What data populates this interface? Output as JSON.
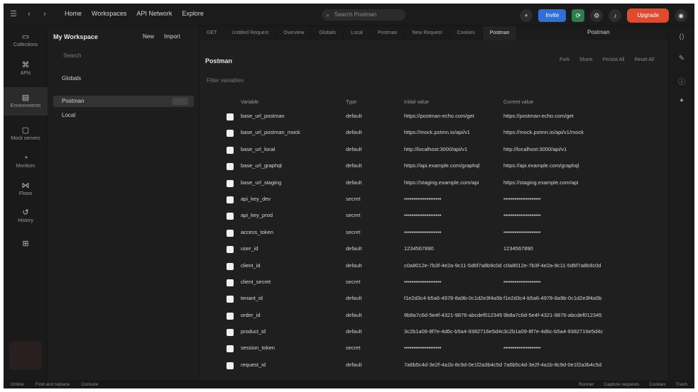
{
  "topbar": {
    "menu": [
      "Home",
      "Workspaces",
      "API Network",
      "Explore"
    ],
    "search_placeholder": "Search Postman",
    "invite_label": "Invite",
    "upgrade_label": "Upgrade"
  },
  "rail": [
    {
      "label": "Collections",
      "icon": "folder-icon"
    },
    {
      "label": "APIs",
      "icon": "api-icon"
    },
    {
      "label": "Environments",
      "icon": "environment-icon"
    },
    {
      "label": "Mock servers",
      "icon": "mock-icon"
    },
    {
      "label": "Monitors",
      "icon": "monitor-icon"
    },
    {
      "label": "Flows",
      "icon": "flow-icon"
    },
    {
      "label": "History",
      "icon": "history-icon"
    }
  ],
  "sidebar": {
    "title": "My Workspace",
    "new_label": "New",
    "import_label": "Import",
    "search_placeholder": "Search",
    "items": [
      "Globals",
      "Postman",
      "Local"
    ]
  },
  "tabs": [
    "GET",
    "Untitled Request",
    "Overview",
    "Globals",
    "Local",
    "Postman",
    "New Request",
    "Cookies",
    "Postman"
  ],
  "env_select": "Postman",
  "workspace": {
    "title": "Postman",
    "actions": [
      "Fork",
      "Share",
      "Persist All",
      "Reset All"
    ],
    "filter_placeholder": "Filter variables"
  },
  "table": {
    "headers": [
      "Variable",
      "Type",
      "Initial value",
      "Current value"
    ],
    "rows": [
      [
        "base_url_postman",
        "default",
        "https://postman-echo.com/get",
        "https://postman-echo.com/get"
      ],
      [
        "base_url_postman_mock",
        "default",
        "https://mock.pstmn.io/api/v1",
        "https://mock.pstmn.io/api/v1/mock"
      ],
      [
        "base_url_local",
        "default",
        "http://localhost:3000/api/v1",
        "http://localhost:3000/api/v1"
      ],
      [
        "base_url_graphql",
        "default",
        "https://api.example.com/graphql",
        "https://api.example.com/graphql"
      ],
      [
        "base_url_staging",
        "default",
        "https://staging.example.com/api",
        "https://staging.example.com/api"
      ],
      [
        "api_key_dev",
        "secret",
        "••••••••••••••••••••",
        "••••••••••••••••••••"
      ],
      [
        "api_key_prod",
        "secret",
        "••••••••••••••••••••",
        "••••••••••••••••••••"
      ],
      [
        "access_token",
        "secret",
        "••••••••••••••••••••",
        "••••••••••••••••••••"
      ],
      [
        "user_id",
        "default",
        "1234567890",
        "1234567890"
      ],
      [
        "client_id",
        "default",
        "c0a8012e-7b3f-4e2a-9c11-5d6f7a8b9c0d",
        "c0a8012e-7b3f-4e2a-9c11-5d6f7a8b9c0d"
      ],
      [
        "client_secret",
        "secret",
        "••••••••••••••••••••",
        "••••••••••••••••••••"
      ],
      [
        "tenant_id",
        "default",
        "f1e2d3c4-b5a6-4978-8a9b-0c1d2e3f4a5b",
        "f1e2d3c4-b5a6-4978-8a9b-0c1d2e3f4a5b"
      ],
      [
        "order_id",
        "default",
        "9b8a7c6d-5e4f-4321-9876-abcdef012345",
        "9b8a7c6d-5e4f-4321-9876-abcdef012345"
      ],
      [
        "product_id",
        "default",
        "3c2b1a09-8f7e-4d6c-b5a4-9382716e5d4c",
        "3c2b1a09-8f7e-4d6c-b5a4-9382716e5d4c"
      ],
      [
        "session_token",
        "secret",
        "••••••••••••••••••••",
        "••••••••••••••••••••"
      ],
      [
        "request_id",
        "default",
        "7a6b5c4d-3e2f-4a1b-8c9d-0e1f2a3b4c5d",
        "7a6b5c4d-3e2f-4a1b-8c9d-0e1f2a3b4c5d"
      ]
    ]
  },
  "statusbar": {
    "left": [
      "Online",
      "Find and replace",
      "Console"
    ],
    "right": [
      "Runner",
      "Capture requests",
      "Cookies",
      "Trash"
    ]
  }
}
